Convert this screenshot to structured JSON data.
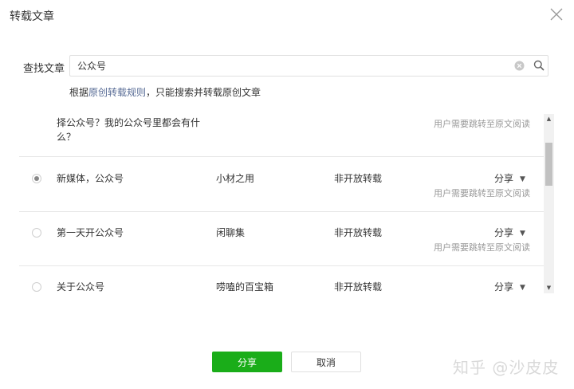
{
  "dialog": {
    "title": "转载文章",
    "close_icon": "close-icon"
  },
  "search": {
    "label": "查找文章",
    "value": "公众号",
    "clear_icon": "clear-icon",
    "search_icon": "search-icon"
  },
  "hint": {
    "prefix": "根据",
    "link": "原创转载规则",
    "suffix": "，只能搜索并转载原创文章"
  },
  "articles": [
    {
      "title": "择公众号？我的公众号里都会有什么？",
      "note": "用户需要跳转至原文阅读"
    },
    {
      "title": "新媒体，公众号",
      "author": "小材之用",
      "permission": "非开放转载",
      "action": "分享",
      "note": "用户需要跳转至原文阅读",
      "selected": true
    },
    {
      "title": "第一天开公众号",
      "author": "闲聊集",
      "permission": "非开放转载",
      "action": "分享",
      "note": "用户需要跳转至原文阅读",
      "selected": false
    },
    {
      "title": "关于公众号",
      "author": "唠嗑的百宝箱",
      "permission": "非开放转载",
      "action": "分享",
      "selected": false
    }
  ],
  "buttons": {
    "confirm": "分享",
    "cancel": "取消"
  },
  "watermark": "知乎 @沙皮皮",
  "colors": {
    "primary": "#1aad19",
    "link": "#576b95"
  }
}
